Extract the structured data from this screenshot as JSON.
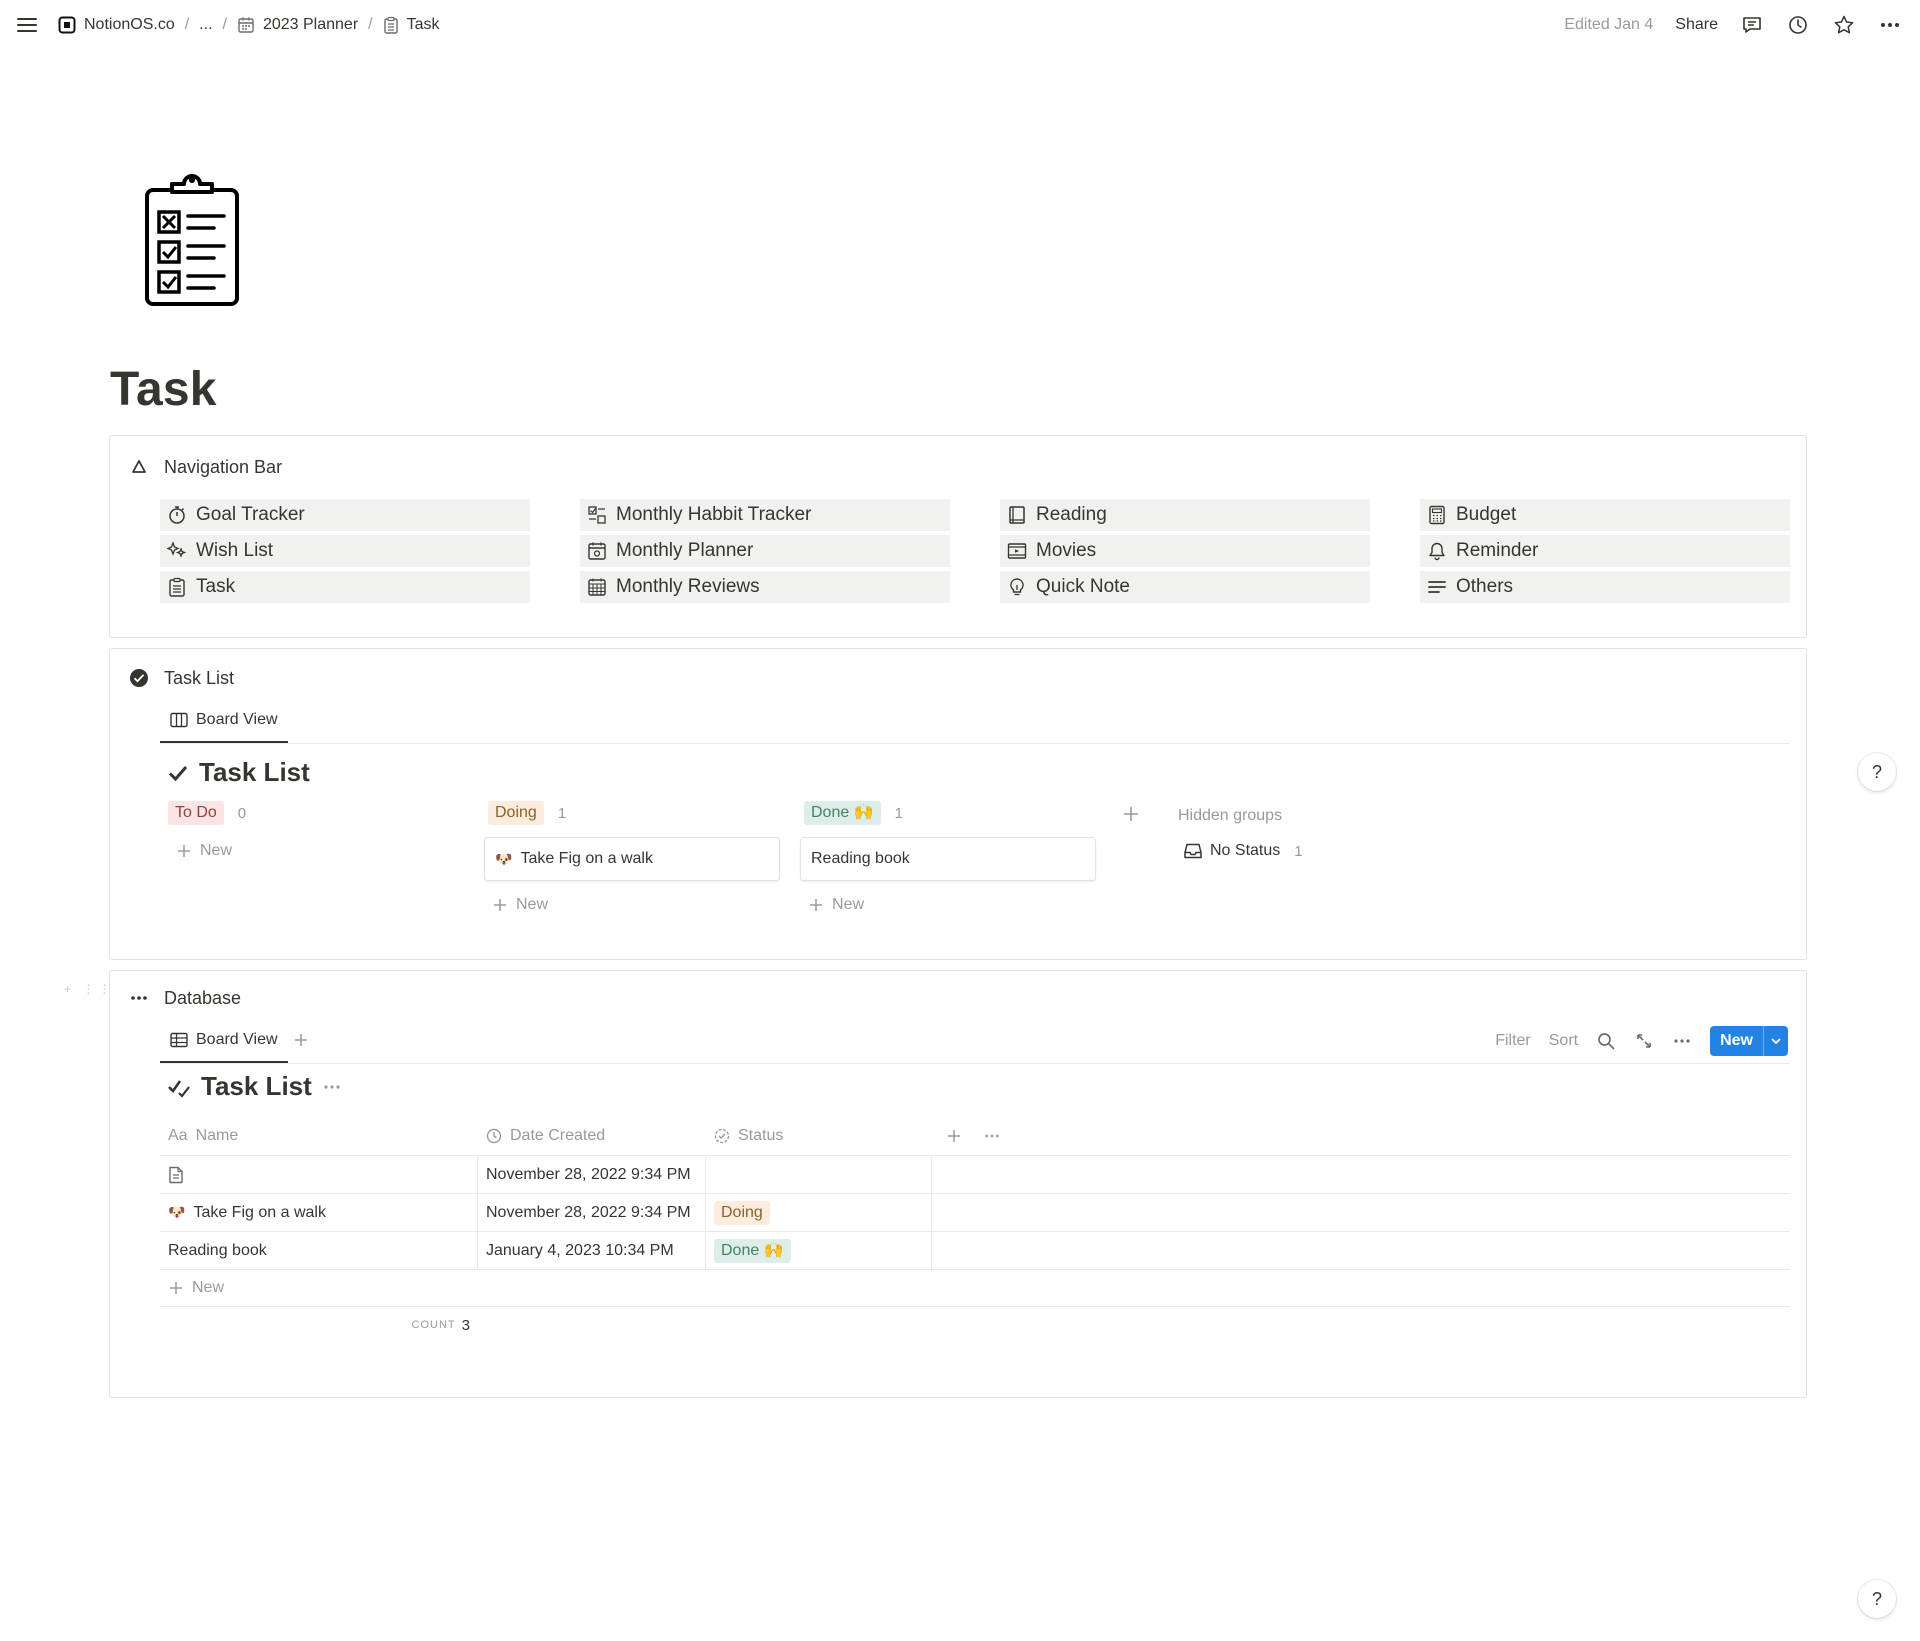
{
  "topbar": {
    "breadcrumbs": [
      "NotionOS.co",
      "...",
      "2023 Planner",
      "Task"
    ],
    "edited": "Edited Jan 4",
    "share": "Share"
  },
  "page": {
    "title": "Task"
  },
  "nav_callout": {
    "title": "Navigation Bar",
    "columns": [
      [
        {
          "label": "Goal Tracker",
          "icon": "stopwatch-icon"
        },
        {
          "label": "Wish List",
          "icon": "sparkles-icon"
        },
        {
          "label": "Task",
          "icon": "clipboard-icon"
        }
      ],
      [
        {
          "label": "Monthly Habbit Tracker",
          "icon": "habit-icon"
        },
        {
          "label": "Monthly Planner",
          "icon": "calendar-icon"
        },
        {
          "label": "Monthly Reviews",
          "icon": "calendar-grid-icon"
        }
      ],
      [
        {
          "label": "Reading",
          "icon": "book-icon"
        },
        {
          "label": "Movies",
          "icon": "film-icon"
        },
        {
          "label": "Quick Note",
          "icon": "lightbulb-icon"
        }
      ],
      [
        {
          "label": "Budget",
          "icon": "calculator-icon"
        },
        {
          "label": "Reminder",
          "icon": "bell-icon"
        },
        {
          "label": "Others",
          "icon": "lines-icon"
        }
      ]
    ]
  },
  "task_callout": {
    "title": "Task List",
    "tab": "Board View",
    "view_title": "Task List",
    "columns": [
      {
        "status": "To Do",
        "count": "0",
        "cards": []
      },
      {
        "status": "Doing",
        "count": "1",
        "cards": [
          {
            "title": "Take Fig on a walk"
          }
        ]
      },
      {
        "status": "Done 🙌",
        "count": "1",
        "cards": [
          {
            "title": "Reading book"
          }
        ]
      }
    ],
    "new_label": "New",
    "hidden_groups": "Hidden groups",
    "no_status": "No Status",
    "no_status_count": "1"
  },
  "db_callout": {
    "title": "Database",
    "tab": "Board View",
    "view_title": "Task List",
    "toolbar": {
      "filter": "Filter",
      "sort": "Sort",
      "new": "New"
    },
    "headers": [
      "Name",
      "Date Created",
      "Status"
    ],
    "name_prefix": "Aa",
    "rows": [
      {
        "name": "",
        "date": "November 28, 2022 9:34 PM",
        "status": ""
      },
      {
        "name": "Take Fig on a walk",
        "date": "November 28, 2022 9:34 PM",
        "status": "Doing"
      },
      {
        "name": "Reading book",
        "date": "January 4, 2023 10:34 PM",
        "status": "Done 🙌"
      }
    ],
    "new_label": "New",
    "count_label": "COUNT",
    "count_value": "3"
  },
  "help": "?",
  "colors": {
    "accent": "#2383e2",
    "text": "#37352f",
    "muted": "#9b9a97",
    "nav_bg": "#f1f1ef"
  }
}
